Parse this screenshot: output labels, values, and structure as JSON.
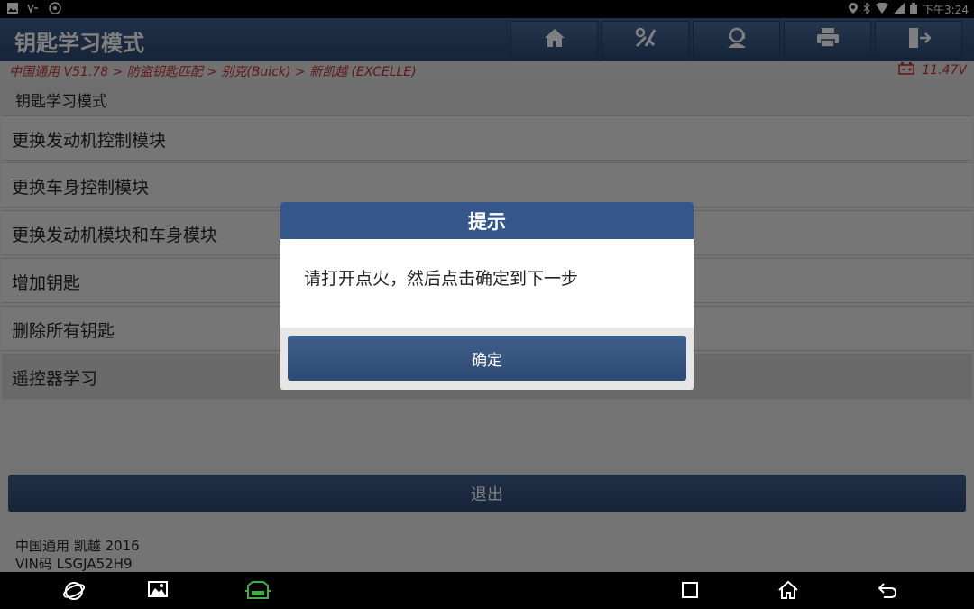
{
  "status_bar": {
    "time": "下午3:24",
    "left_icons": [
      "image-icon",
      "voicemail-icon",
      "settings-icon"
    ],
    "right_icons": [
      "location-icon",
      "bluetooth-icon",
      "wifi-icon",
      "signal-icon",
      "battery-icon"
    ]
  },
  "header": {
    "title": "钥匙学习模式",
    "toolbar": [
      "home-icon",
      "diagnostics-icon",
      "support-icon",
      "print-icon",
      "exit-icon"
    ]
  },
  "breadcrumb": {
    "path": "中国通用 V51.78 > 防盗钥匙匹配 > 别克(Buick) > 新凯越 (EXCELLE)",
    "voltage": "11.47V"
  },
  "main": {
    "section_title": "钥匙学习模式",
    "items": [
      {
        "label": "更换发动机控制模块"
      },
      {
        "label": "更换车身控制模块"
      },
      {
        "label": "更换发动机模块和车身模块"
      },
      {
        "label": "增加钥匙"
      },
      {
        "label": "删除所有钥匙"
      },
      {
        "label": "遥控器学习"
      }
    ],
    "exit_label": "退出"
  },
  "footer": {
    "vehicle": "中国通用 凯越 2016",
    "vin": "VIN码 LSGJA52H9"
  },
  "dialog": {
    "title": "提示",
    "message": "请打开点火，然后点击确定到下一步",
    "ok_label": "确定"
  },
  "colors": {
    "header_blue": "#34568a",
    "breadcrumb_red": "#c0312c",
    "vci_green": "#3cb043"
  }
}
